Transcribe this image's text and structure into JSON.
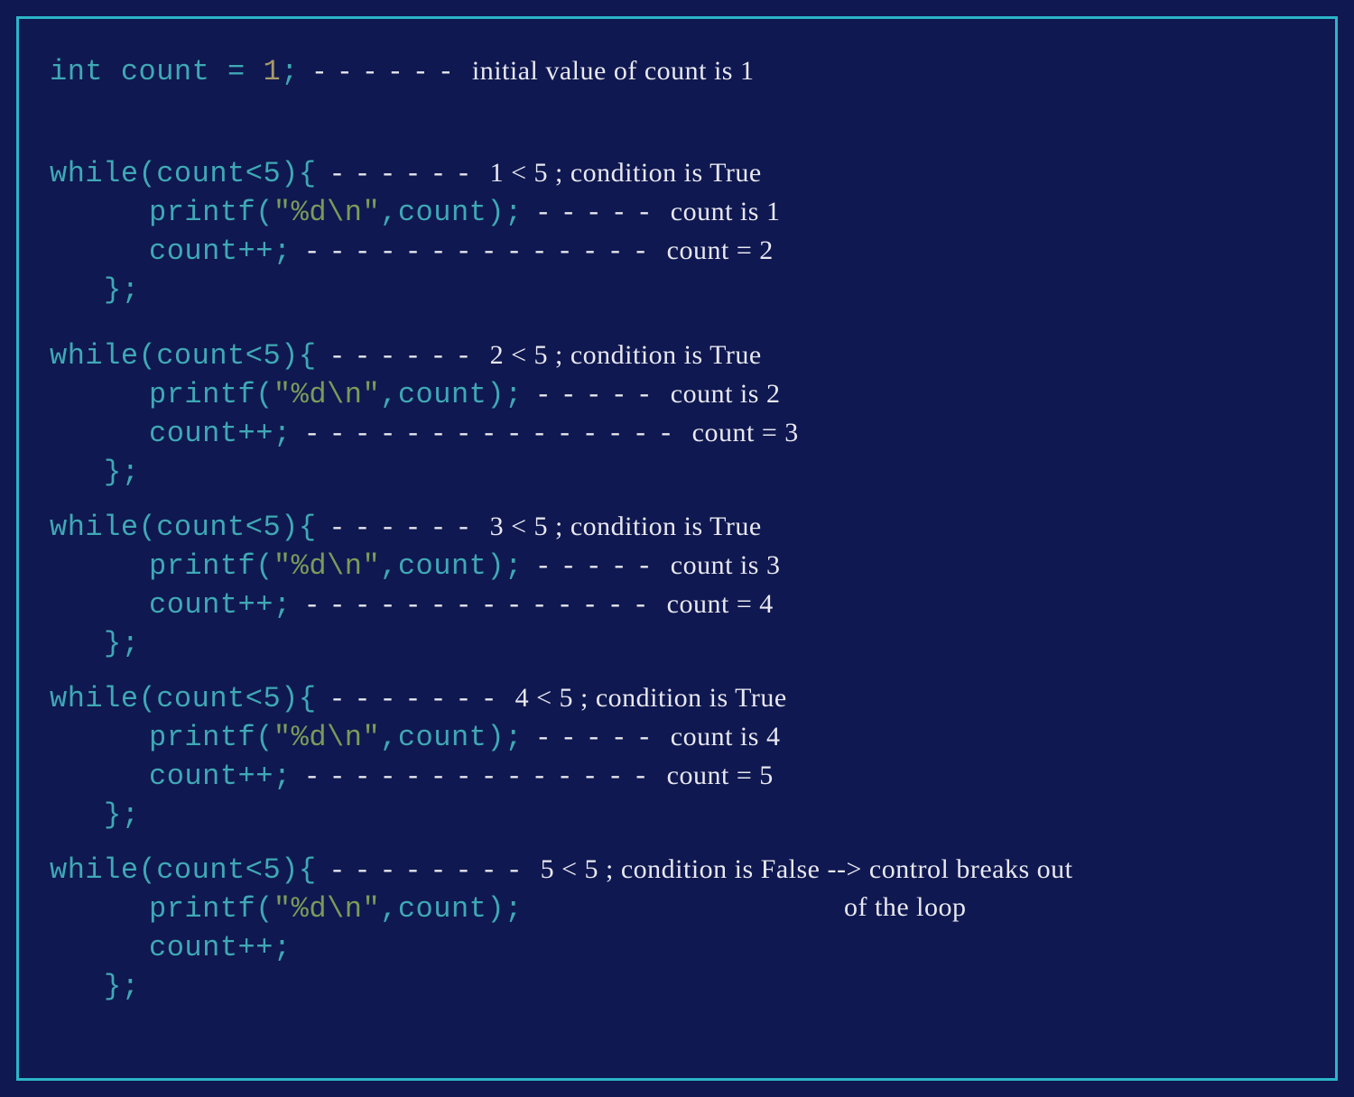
{
  "colors": {
    "background": "#0f1850",
    "border": "#2bb5c9",
    "code_text": "#3fa8b5",
    "number": "#a89a6a",
    "string": "#7a9b5a",
    "annotation": "#e8e8f0"
  },
  "init": {
    "code_kw": "int",
    "code_rest": " count = ",
    "code_num": "1",
    "code_end": ";",
    "dash": "------",
    "annot": "initial value of count is 1"
  },
  "blocks": [
    {
      "while_code": "while(count<5){",
      "while_dash": "------",
      "while_annot": "1 < 5 ; condition is True",
      "print_pre": "printf(",
      "print_str": "\"%d\\n\"",
      "print_post": ",count);",
      "print_dash": "-----",
      "print_annot": " count is 1",
      "inc_code": "count++;",
      "inc_dash": "--------------",
      "inc_annot": "count = 2",
      "close": "};"
    },
    {
      "while_code": "while(count<5){",
      "while_dash": "------",
      "while_annot": "2 < 5 ; condition is True",
      "print_pre": "printf(",
      "print_str": "\"%d\\n\"",
      "print_post": ",count);",
      "print_dash": "-----",
      "print_annot": "count is 2",
      "inc_code": "count++;",
      "inc_dash": "---------------",
      "inc_annot": "count = 3",
      "close": "};"
    },
    {
      "while_code": "while(count<5){",
      "while_dash": "------",
      "while_annot": "3 < 5 ; condition is True",
      "print_pre": "printf(",
      "print_str": "\"%d\\n\"",
      "print_post": ",count);",
      "print_dash": "-----",
      "print_annot": " count is 3",
      "inc_code": "count++;",
      "inc_dash": "--------------",
      "inc_annot": " count = 4",
      "close": "};"
    },
    {
      "while_code": "while(count<5){",
      "while_dash": "-------",
      "while_annot": "4 < 5 ; condition is True",
      "print_pre": "printf(",
      "print_str": "\"%d\\n\"",
      "print_post": ",count);",
      "print_dash": "-----",
      "print_annot": " count is 4",
      "inc_code": "count++;",
      "inc_dash": "--------------",
      "inc_annot": " count = 5",
      "close": "};"
    }
  ],
  "final": {
    "while_code": "while(count<5){",
    "while_dash": "--------",
    "while_annot": "5 < 5 ; condition is False --> control breaks out",
    "print_pre": "printf(",
    "print_str": "\"%d\\n\"",
    "print_post": ",count);",
    "annot_line2": "of the loop",
    "inc_code": "count++;",
    "close": "};"
  }
}
